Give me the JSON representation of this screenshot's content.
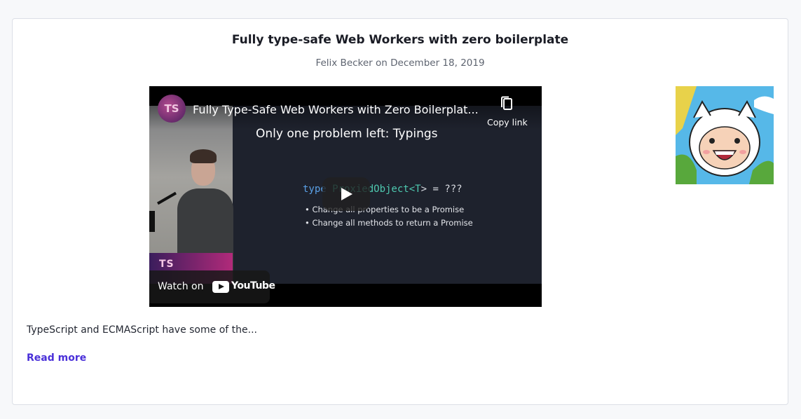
{
  "post": {
    "title": "Fully type-safe Web Workers with zero boilerplate",
    "byline": "Felix Becker on December 18, 2019",
    "excerpt": "TypeScript and ECMAScript have some of the...",
    "read_more_label": "Read more"
  },
  "video": {
    "title": "Fully Type-Safe Web Workers with Zero Boilerplat...",
    "channel_avatar_text": "TS",
    "copy_link_label": "Copy link",
    "watch_on_label": "Watch on",
    "youtube_wordmark": "YouTube",
    "slide": {
      "heading": "Only one problem left: Typings",
      "code_keyword": "type",
      "code_name": " ProxiedObject<",
      "code_param": "T",
      "code_rest": "> = ???",
      "bullets": [
        "• Change all properties to be a Promise",
        "• Change all methods to return a Promise"
      ],
      "banner_text": "TS"
    }
  },
  "colors": {
    "link": "#4a30d9",
    "background": "#f7f8fa",
    "card_border": "#dcdfe6"
  }
}
